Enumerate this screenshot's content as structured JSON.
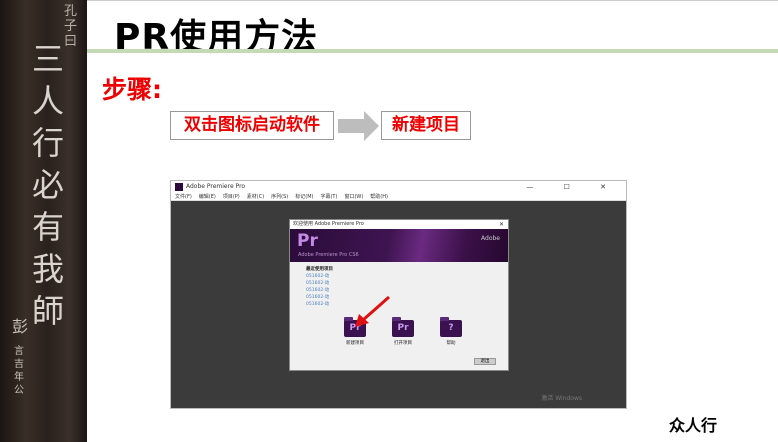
{
  "side_panel": {
    "small_text": "孔子曰",
    "big_text": "三人行必有我師",
    "signature": "彭",
    "signature_small": "言吉年公"
  },
  "header": {
    "title": "PR使用方法"
  },
  "steps": {
    "label": "步骤:",
    "step1": "双击图标启动软件",
    "step2": "新建项目"
  },
  "screenshot": {
    "window_title": "Adobe Premiere Pro",
    "window_buttons": "— ☐ ✕",
    "menu": [
      "文件(F)",
      "编辑(E)",
      "项目(P)",
      "素材(C)",
      "序列(S)",
      "标记(M)",
      "字幕(T)",
      "窗口(W)",
      "帮助(H)"
    ],
    "dialog": {
      "title": "欢迎使用 Adobe Premiere Pro",
      "close": "✕",
      "logo": "Pr",
      "product": "Adobe Premiere Pro CS6",
      "adobe": "Adobe",
      "recent_header": "最近使用项目",
      "recent": [
        "051602-动",
        "051602-动",
        "051602-动",
        "051602-动",
        "051602-动"
      ],
      "actions": [
        {
          "icon": "Pr",
          "label": "新建项目"
        },
        {
          "icon": "Pr",
          "label": "打开项目"
        },
        {
          "icon": "?",
          "label": "帮助"
        }
      ],
      "exit": "退出"
    },
    "watermark": "激活 Windows"
  },
  "footer": {
    "text": "众人行"
  },
  "colors": {
    "accent_red": "#ee0000",
    "green_line": "#c4d9b4",
    "premiere_purple": "#3a1250"
  }
}
